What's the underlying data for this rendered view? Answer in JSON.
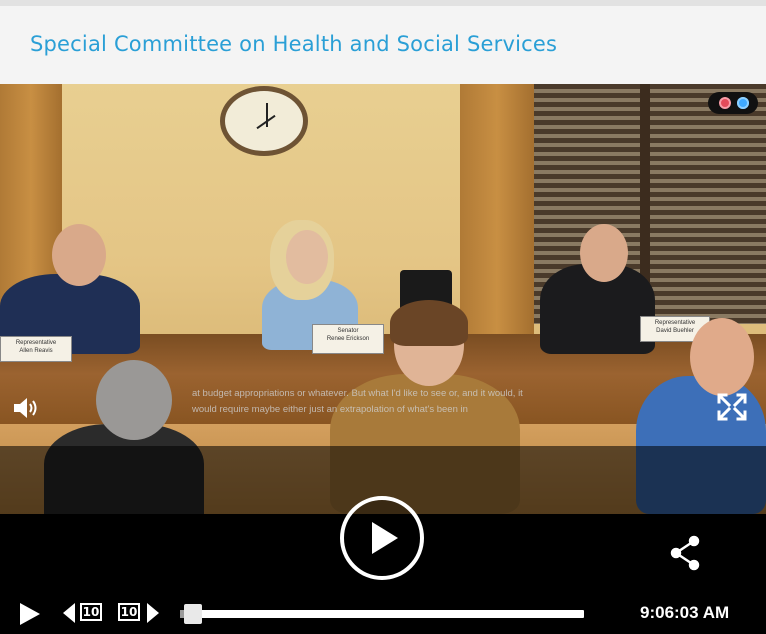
{
  "header": {
    "title": "Special Committee on Health and Social Services"
  },
  "video": {
    "caption_line1": "at budget appropriations or whatever. But what I'd like to see or, and it would, it",
    "caption_line2": "would require maybe either just an extrapolation of what's been in",
    "nameplates": [
      {
        "role": "Representative",
        "name": "Allen Reavis"
      },
      {
        "role": "Senator",
        "name": "Renee Erickson"
      },
      {
        "role": "Representative",
        "name": "David Buehler"
      }
    ]
  },
  "player": {
    "skip_back_seconds": "10",
    "skip_forward_seconds": "10",
    "progress": 0.02,
    "current_time": "9:06:03 AM"
  },
  "colors": {
    "header_title": "#2a9fd6",
    "header_bg": "#f4f4f4",
    "controls_bg": "#000000",
    "badge_red": "#e34b5a",
    "badge_blue": "#3fa9ff"
  },
  "icons": {
    "volume": "volume-icon",
    "fullscreen": "fullscreen-icon",
    "play": "play-icon",
    "share": "share-icon",
    "skip_back": "skip-back-icon",
    "skip_forward": "skip-forward-icon"
  }
}
